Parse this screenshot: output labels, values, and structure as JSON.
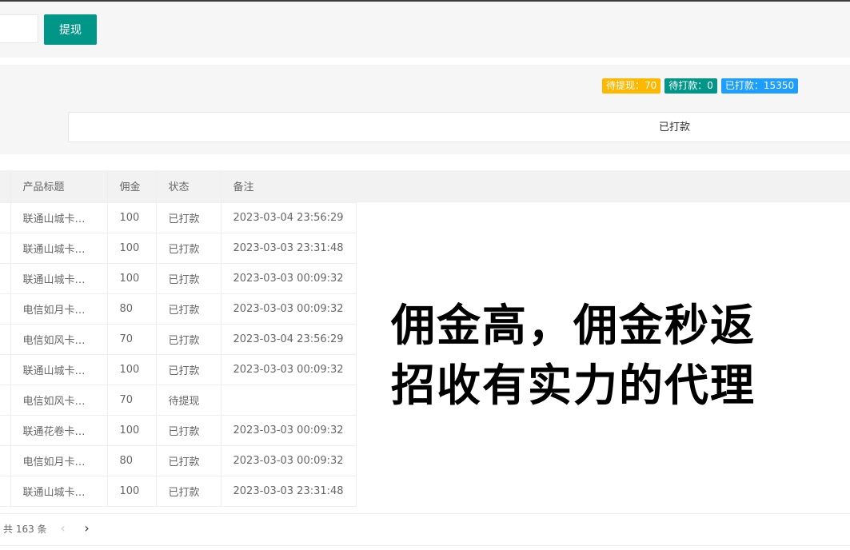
{
  "toolbar": {
    "amount_placeholder": "",
    "withdraw_label": "提现"
  },
  "stats": {
    "pending_withdraw": "待提现：70",
    "waiting_payment": "待打款：0",
    "paid": "已打款：15350"
  },
  "filter": {
    "status_value": "已打款"
  },
  "table": {
    "columns": [
      "产品标题",
      "佣金",
      "状态",
      "备注"
    ],
    "rows": [
      [
        "联通山城卡…",
        "100",
        "已打款",
        "2023-03-04 23:56:29"
      ],
      [
        "联通山城卡…",
        "100",
        "已打款",
        "2023-03-03 23:31:48"
      ],
      [
        "联通山城卡…",
        "100",
        "已打款",
        "2023-03-03 00:09:32"
      ],
      [
        "电信如月卡…",
        "80",
        "已打款",
        "2023-03-03 00:09:32"
      ],
      [
        "电信如风卡…",
        "70",
        "已打款",
        "2023-03-04 23:56:29"
      ],
      [
        "联通山城卡…",
        "100",
        "已打款",
        "2023-03-03 00:09:32"
      ],
      [
        "电信如风卡…",
        "70",
        "待提现",
        ""
      ],
      [
        "联通花卷卡…",
        "100",
        "已打款",
        "2023-03-03 00:09:32"
      ],
      [
        "电信如月卡…",
        "80",
        "已打款",
        "2023-03-03 00:09:32"
      ],
      [
        "联通山城卡…",
        "100",
        "已打款",
        "2023-03-03 23:31:48"
      ]
    ]
  },
  "pagination": {
    "total_label": "共 163 条",
    "prev_icon": "chevron-left-icon",
    "next_icon": "chevron-right-icon"
  },
  "overlay": {
    "line1": "佣金高，佣金秒返",
    "line2": "招收有实力的代理"
  }
}
